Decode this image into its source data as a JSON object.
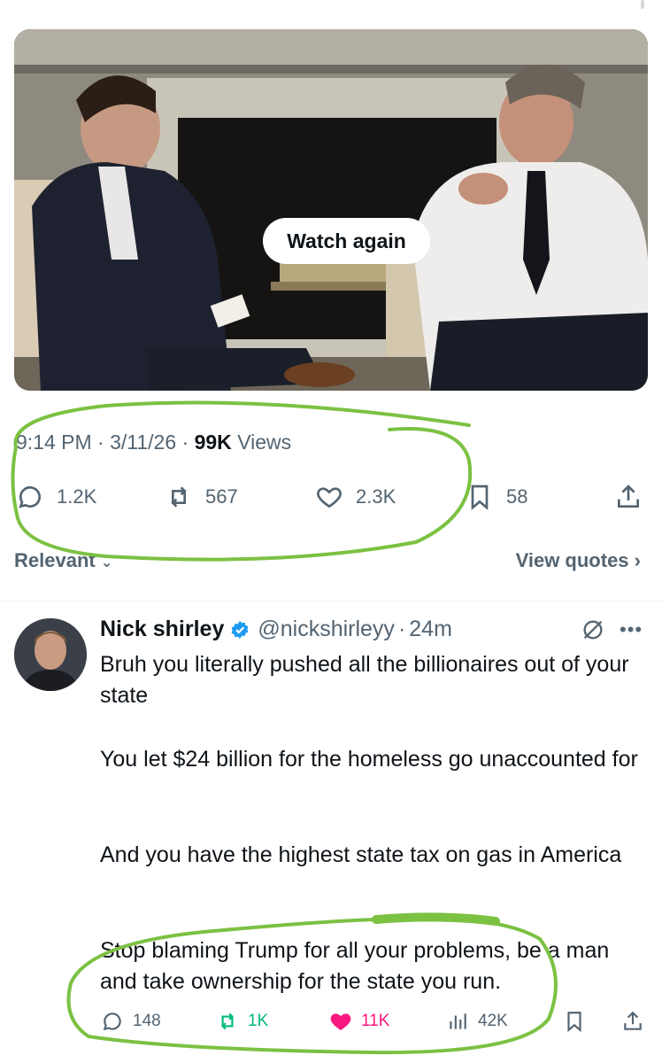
{
  "video": {
    "watch_again_label": "Watch again"
  },
  "tweet_meta": {
    "time": "9:14 PM",
    "date": "3/11/26",
    "views_count": "99K",
    "views_label": "Views"
  },
  "tweet_stats": {
    "replies": "1.2K",
    "reposts": "567",
    "likes": "2.3K",
    "bookmarks": "58"
  },
  "replies_filter": {
    "sort_label": "Relevant",
    "view_quotes_label": "View quotes"
  },
  "reply": {
    "name": "Nick shirley",
    "handle": "@nickshirleyy",
    "time_ago": "24m",
    "paragraphs": [
      "Bruh you literally pushed all the billionaires out of your state",
      "You let $24 billion for the homeless go unaccounted for",
      "And you have the highest state tax on gas in America",
      "Stop blaming Trump for all your problems, be a man and take ownership for the state you run."
    ],
    "stats": {
      "replies": "148",
      "reposts": "1K",
      "likes": "11K",
      "views": "42K"
    },
    "like_color": "#f91880",
    "repost_color": "#00ba7c"
  },
  "colors": {
    "annotation_green": "#7bc142",
    "verified_blue": "#1d9bf0",
    "secondary_text": "#536471"
  }
}
